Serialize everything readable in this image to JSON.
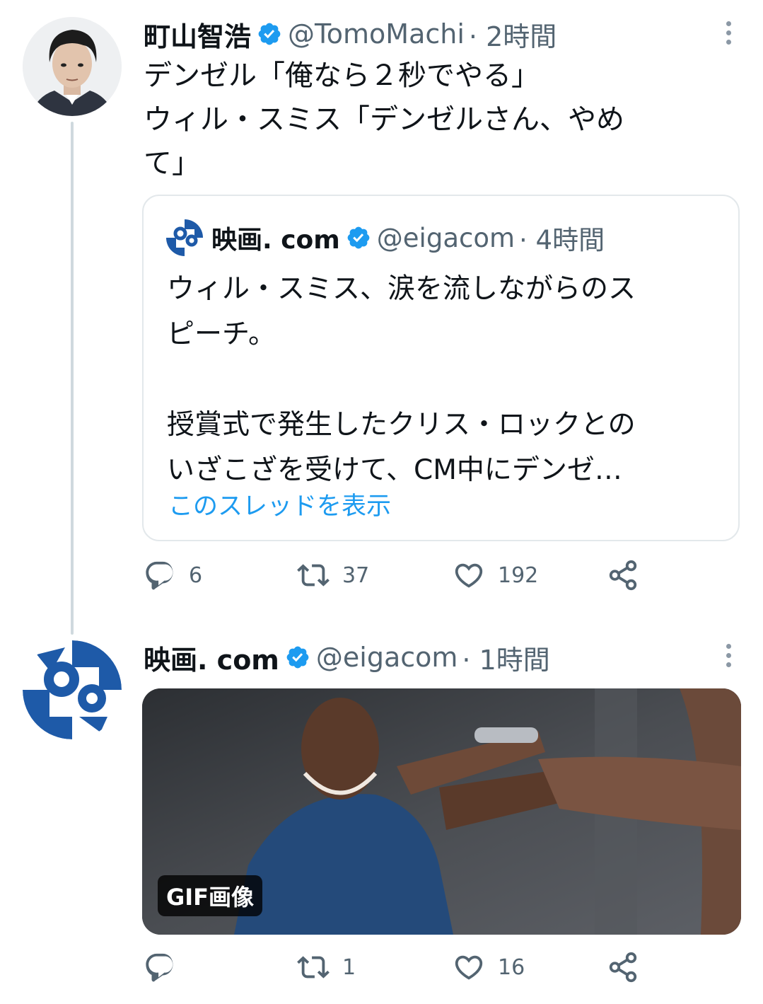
{
  "tweet1": {
    "name": "町山智浩",
    "handle": "@TomoMachi",
    "time": "· 2時間",
    "lines": [
      "デンゼル「俺なら２秒でやる」",
      "ウィル・スミス「デンゼルさん、やめ",
      "て」"
    ],
    "quote": {
      "name": "映画. com",
      "handle": "@eigacom",
      "time": "· 4時間",
      "lines": [
        "ウィル・スミス、涙を流しながらのス",
        "ピーチ。",
        "",
        "授賞式で発生したクリス・ロックとの",
        "いざこざを受けて、CM中にデンゼ…"
      ],
      "thread_link": "このスレッドを表示"
    },
    "actions": {
      "replies": "6",
      "retweets": "37",
      "likes": "192"
    }
  },
  "tweet2": {
    "name": "映画. com",
    "handle": "@eigacom",
    "time": "· 1時間",
    "media_badge": "GIF画像",
    "actions": {
      "replies": "",
      "retweets": "1",
      "likes": "16"
    }
  },
  "colors": {
    "accent": "#1d9bf0",
    "muted": "#536471",
    "verified": "#1d9bf0",
    "eiga_blue": "#1e5aa8"
  },
  "icons": [
    "verified-icon",
    "more-icon",
    "reply-icon",
    "retweet-icon",
    "like-icon",
    "share-icon"
  ]
}
